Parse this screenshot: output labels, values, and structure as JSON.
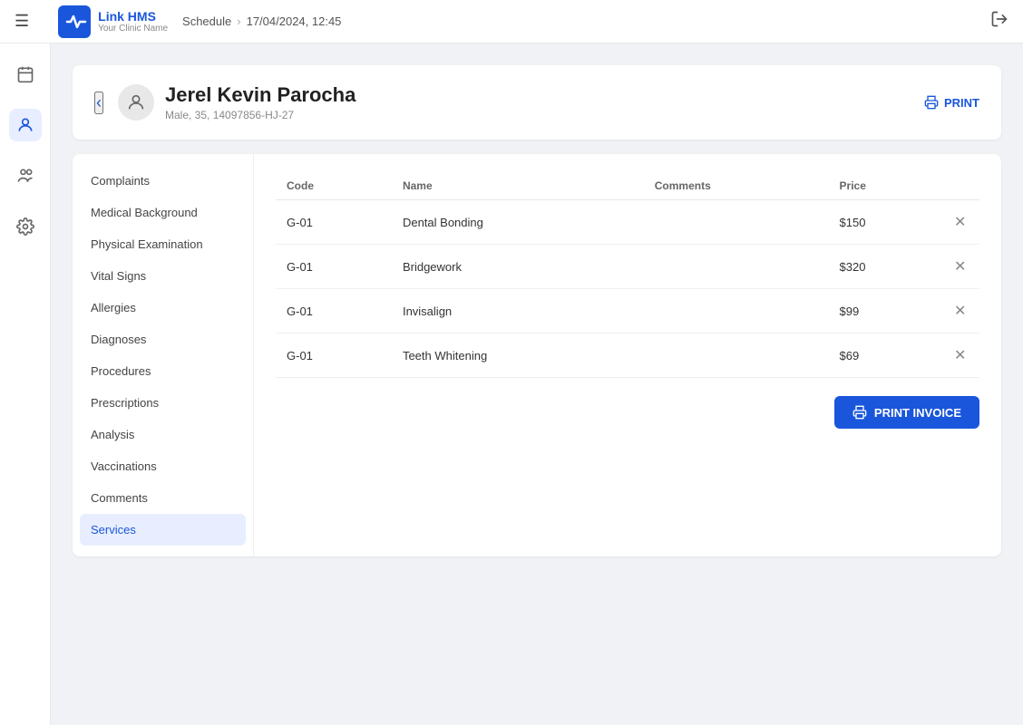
{
  "topbar": {
    "logo_text": "Link HMS",
    "logo_sub": "Your Clinic Name",
    "breadcrumb_schedule": "Schedule",
    "breadcrumb_separator": "›",
    "breadcrumb_date": "17/04/2024, 12:45",
    "logout_label": "Logout"
  },
  "patient": {
    "name": "Jerel Kevin Parocha",
    "meta": "Male, 35, 14097856-HJ-27",
    "print_label": "PRINT"
  },
  "left_nav": {
    "items": [
      {
        "label": "Complaints",
        "active": false
      },
      {
        "label": "Medical Background",
        "active": false
      },
      {
        "label": "Physical Examination",
        "active": false
      },
      {
        "label": "Vital Signs",
        "active": false
      },
      {
        "label": "Allergies",
        "active": false
      },
      {
        "label": "Diagnoses",
        "active": false
      },
      {
        "label": "Procedures",
        "active": false
      },
      {
        "label": "Prescriptions",
        "active": false
      },
      {
        "label": "Analysis",
        "active": false
      },
      {
        "label": "Vaccinations",
        "active": false
      },
      {
        "label": "Comments",
        "active": false
      },
      {
        "label": "Services",
        "active": true
      }
    ]
  },
  "services_table": {
    "columns": [
      "Code",
      "Name",
      "Comments",
      "Price"
    ],
    "rows": [
      {
        "code": "G-01",
        "name": "Dental Bonding",
        "comments": "",
        "price": "$150"
      },
      {
        "code": "G-01",
        "name": "Bridgework",
        "comments": "",
        "price": "$320"
      },
      {
        "code": "G-01",
        "name": "Invisalign",
        "comments": "",
        "price": "$99"
      },
      {
        "code": "G-01",
        "name": "Teeth Whitening",
        "comments": "",
        "price": "$69"
      }
    ],
    "print_invoice_label": "PRINT INVOICE"
  }
}
